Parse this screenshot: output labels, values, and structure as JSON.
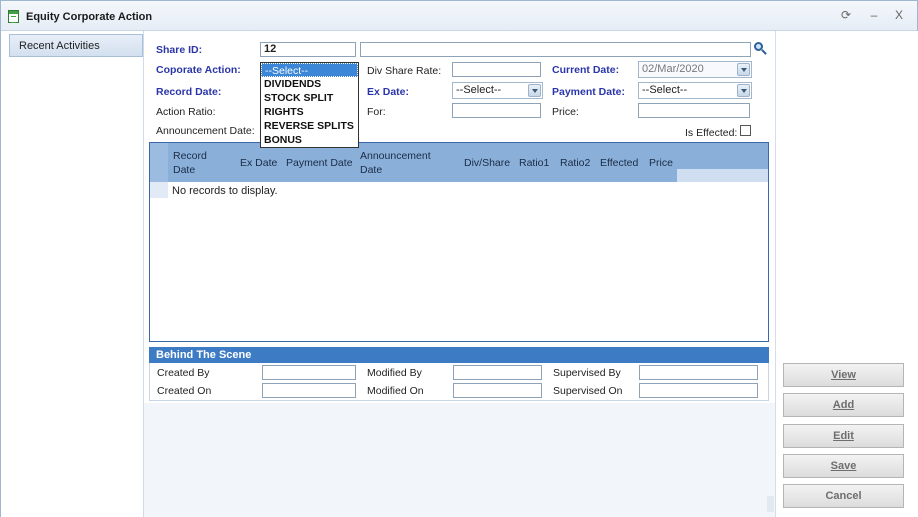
{
  "window": {
    "title": "Equity Corporate Action",
    "controls": {
      "refresh": "⟳",
      "minimize": "–",
      "close": "X"
    }
  },
  "sidebar": {
    "items": [
      {
        "label": "Recent Activities"
      }
    ]
  },
  "form": {
    "share_id_label": "Share ID:",
    "share_id_value": "12",
    "share_name_value": "",
    "corporate_action_label": "Coporate Action:",
    "div_share_rate_label": "Div Share Rate:",
    "current_date_label": "Current Date:",
    "current_date_value": "02/Mar/2020",
    "record_date_label": "Record Date:",
    "ex_date_label": "Ex Date:",
    "ex_date_value": "--Select--",
    "payment_date_label": "Payment Date:",
    "payment_date_value": "--Select--",
    "action_ratio_label": "Action Ratio:",
    "for_label": "For:",
    "price_label": "Price:",
    "announcement_date_label": "Announcement Date:",
    "is_effected_label": "Is Effected:"
  },
  "corporate_action_dropdown": {
    "options": [
      "--Select--",
      "DIVIDENDS",
      "STOCK SPLIT",
      "RIGHTS",
      "REVERSE SPLITS",
      "BONUS"
    ],
    "selected_index": 0
  },
  "grid": {
    "columns": [
      {
        "line1": "Record",
        "line2": "Date"
      },
      {
        "line1": "Ex Date",
        "line2": ""
      },
      {
        "line1": "Payment Date",
        "line2": ""
      },
      {
        "line1": "Announcement",
        "line2": "Date"
      },
      {
        "line1": "Div/Share",
        "line2": ""
      },
      {
        "line1": "Ratio1",
        "line2": ""
      },
      {
        "line1": "Ratio2",
        "line2": ""
      },
      {
        "line1": "Effected",
        "line2": ""
      },
      {
        "line1": "Price",
        "line2": ""
      }
    ],
    "empty_text": "No records to display."
  },
  "behind_the_scene": {
    "title": "Behind The Scene",
    "created_by_label": "Created By",
    "created_on_label": "Created On",
    "modified_by_label": "Modified By",
    "modified_on_label": "Modified On",
    "supervised_by_label": "Supervised By",
    "supervised_on_label": "Supervised On"
  },
  "buttons": {
    "view": "View",
    "add": "Add",
    "edit": "Edit",
    "save": "Save",
    "cancel": "Cancel"
  },
  "colors": {
    "grid_header": "#8ab0da",
    "section_bar": "#3d7cc4",
    "label_blue": "#2a36a8",
    "dropdown_highlight": "#3b86d6"
  }
}
